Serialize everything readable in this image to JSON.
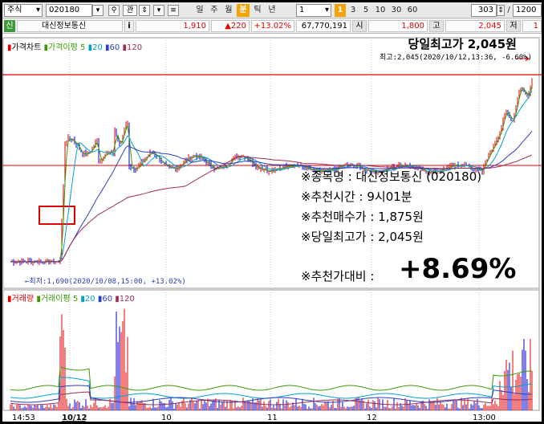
{
  "toolbar": {
    "market": "주식",
    "code": "020180",
    "related_label": "관",
    "periods": [
      "일",
      "주",
      "월",
      "분",
      "틱",
      "년"
    ],
    "active_period": "분",
    "interval_value": "1",
    "minute_options": [
      "1",
      "3",
      "5",
      "10",
      "30",
      "60"
    ],
    "active_minute": "1",
    "count_value": "303",
    "slash": "/",
    "total_value": "1200"
  },
  "infobar": {
    "badge": "신",
    "stock_name": "대신정보통신",
    "info_icon": "i",
    "price": "1,910",
    "change": "▲220",
    "change_pct": "+13.02%",
    "volume": "67,770,191",
    "open_label": "시",
    "open_value": "1,800",
    "high_label": "고",
    "high_value": "2,045",
    "low_label": "저",
    "low_value": "1"
  },
  "price_panel": {
    "legend_title": "가격차트",
    "legend_ma_label": "가격이평",
    "legend_ma_values": [
      "5",
      "20",
      "60",
      "120"
    ],
    "high_headline": "당일최고가 2,045원",
    "high_marker": "최고:2,045(2020/10/12,13:36, -6.60%)",
    "low_marker": "←최저:1,690(2020/10/08,15:00, +13.02%)",
    "high_line_price": 2045,
    "rec_line_price": 1875
  },
  "annotations": {
    "lines": [
      "※종목명 : 대신정보통신 (020180)",
      "※추천시간 : 9시01분",
      "※추천매수가 : 1,875원",
      "※당일최고가 : 2,045원"
    ],
    "compare_label": "※추천가대비 :",
    "compare_value": "+8.69%"
  },
  "volume_panel": {
    "legend_title": "거래량",
    "legend_ma_label": "거래이평",
    "legend_ma_values": [
      "5",
      "20",
      "60",
      "120"
    ]
  },
  "x_axis": {
    "labels": [
      "14:53",
      "10/12",
      "10",
      "11",
      "12",
      "13:00"
    ]
  },
  "colors": {
    "up": "#e00000",
    "down": "#0000cc",
    "ma5": "#3c9a00",
    "ma20": "#00a0d0",
    "ma60": "#2b3fc0",
    "ma120": "#9b2c5a",
    "high_line": "#e00000"
  }
}
